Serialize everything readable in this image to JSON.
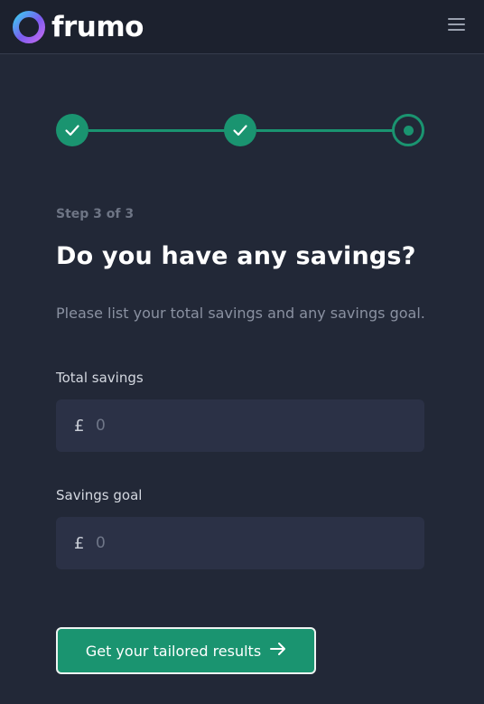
{
  "brand": {
    "name": "frumo",
    "accent": "#1a9470",
    "logo_gradient": [
      "#3ec6f0",
      "#7b5cf0",
      "#c06af0"
    ]
  },
  "header": {
    "menu_icon": "hamburger-menu-icon"
  },
  "stepper": {
    "total_steps": 3,
    "current_step": 3,
    "steps": [
      {
        "state": "completed",
        "icon": "checkmark-icon"
      },
      {
        "state": "completed",
        "icon": "checkmark-icon"
      },
      {
        "state": "current",
        "icon": "dot-icon"
      }
    ]
  },
  "step_label": "Step 3 of 3",
  "heading": "Do you have any savings?",
  "subtitle": "Please list your total savings and any savings goal.",
  "fields": {
    "total_savings": {
      "label": "Total savings",
      "currency": "£",
      "value": "",
      "placeholder": "0"
    },
    "savings_goal": {
      "label": "Savings goal",
      "currency": "£",
      "value": "",
      "placeholder": "0"
    }
  },
  "cta": {
    "label": "Get your tailored results",
    "icon": "arrow-right-icon"
  }
}
